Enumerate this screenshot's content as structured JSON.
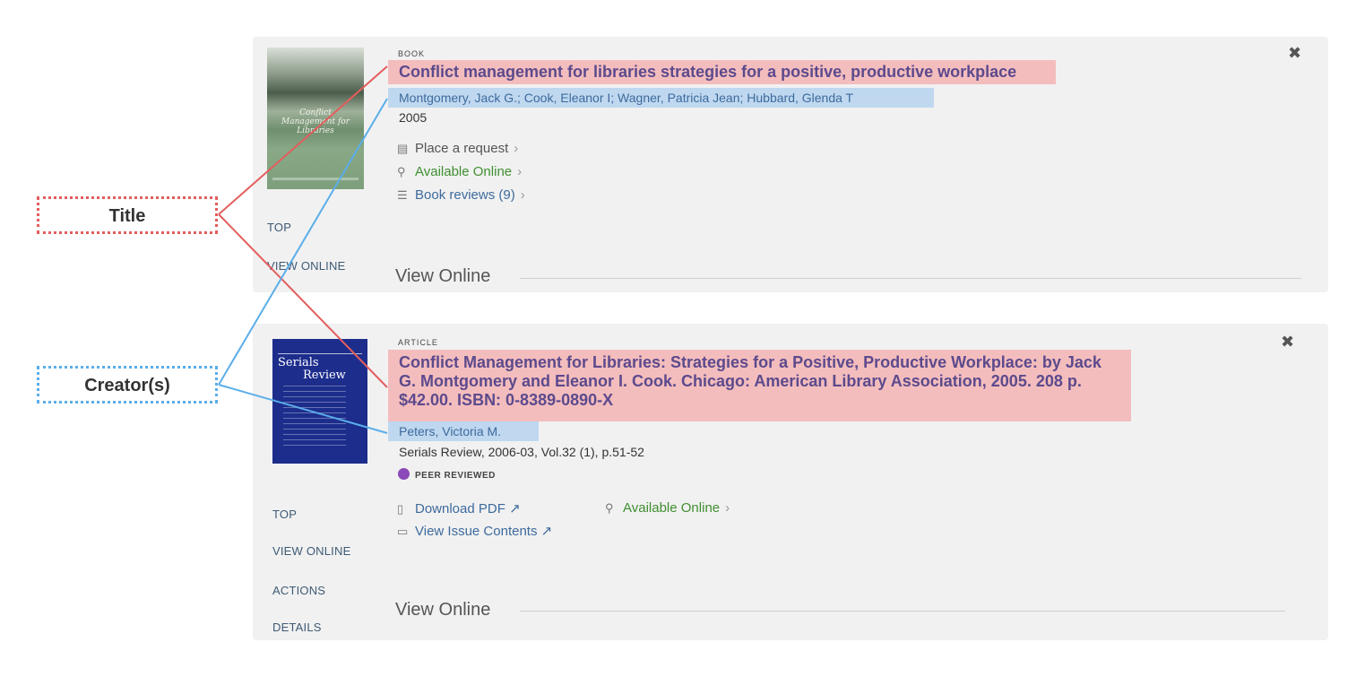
{
  "annotations": {
    "title_label": "Title",
    "creator_label": "Creator(s)",
    "title_color": "#e35d5d",
    "creator_color": "#5aaeea",
    "title_highlight": "#f4bdbd",
    "creator_highlight": "#bfd8f0"
  },
  "results": [
    {
      "type": "BOOK",
      "title": "Conflict management for libraries strategies for a positive, productive workplace",
      "creators": "Montgomery, Jack G.; Cook, Eleanor I; Wagner, Patricia Jean; Hubbard, Glenda T",
      "date": "2005",
      "cover": {
        "text": "Conflict Management for Libraries"
      },
      "links": [
        {
          "icon": "book-request-icon",
          "glyph": "▤",
          "label": "Place a request",
          "chevron": "›"
        },
        {
          "icon": "link-icon",
          "glyph": "🔗",
          "label": "Available Online",
          "chevron": "›",
          "color": "#3f8f2f"
        },
        {
          "icon": "reviews-icon",
          "glyph": "☰",
          "label": "Book reviews (9)",
          "chevron": "›"
        }
      ],
      "side_nav": [
        "TOP",
        "VIEW ONLINE"
      ],
      "section_heading": "View Online",
      "pin_icon": "unpin-icon"
    },
    {
      "type": "ARTICLE",
      "title": "Conflict Management for Libraries: Strategies for a Positive, Productive Workplace: by Jack G. Montgomery and Eleanor I. Cook. Chicago: American Library Association, 2005. 208 p. $42.00. ISBN: 0-8389-0890-X",
      "title_lines": [
        "Conflict Management for Libraries: Strategies for a Positive, Productive Workplace: by Jack",
        "G. Montgomery and Eleanor I. Cook. Chicago: American Library Association, 2005. 208 p.",
        "$42.00. ISBN: 0-8389-0890-X"
      ],
      "creators": "Peters, Victoria M.",
      "source": "Serials Review, 2006-03, Vol.32 (1), p.51-52",
      "peer_reviewed": "PEER REVIEWED",
      "cover": {
        "text_line1": "Serials",
        "text_line2": "Review"
      },
      "links": [
        {
          "icon": "pdf-icon",
          "label": "Download PDF",
          "external": "↗"
        },
        {
          "icon": "link-icon",
          "label": "Available Online",
          "chevron": "›",
          "color": "#3f8f2f"
        },
        {
          "icon": "open-book-icon",
          "label": "View Issue Contents",
          "external": "↗"
        }
      ],
      "side_nav": [
        "TOP",
        "VIEW ONLINE",
        "ACTIONS",
        "DETAILS"
      ],
      "section_heading": "View Online",
      "pin_icon": "unpin-icon"
    }
  ]
}
